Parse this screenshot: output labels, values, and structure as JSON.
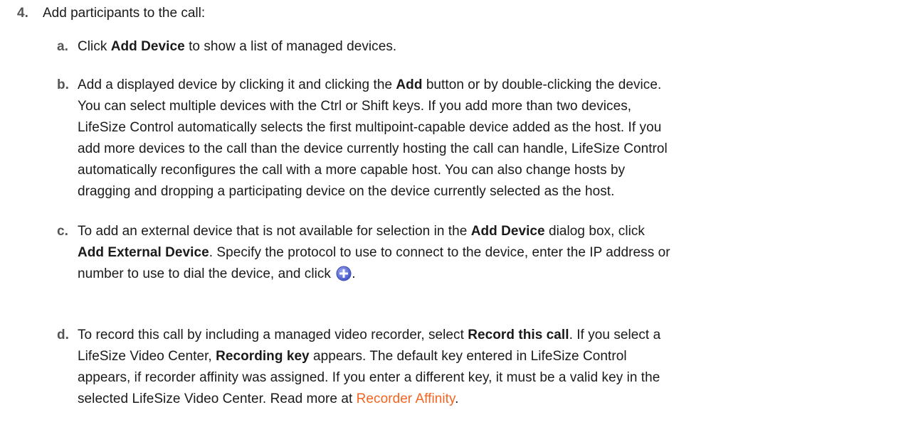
{
  "step": {
    "number": "4.",
    "text": "Add participants to the call:"
  },
  "substeps": [
    {
      "letter": "a.",
      "parts": [
        "Click ",
        "Add Device",
        " to show a list of managed devices."
      ]
    },
    {
      "letter": "b.",
      "lines": [
        [
          "Add a displayed device by clicking it and clicking the ",
          "Add",
          " button or by double-clicking the device."
        ],
        [
          "You can select multiple devices with the Ctrl or Shift keys. If you add more than two devices,"
        ],
        [
          "LifeSize Control automatically selects the first multipoint-capable device added as the host. If you"
        ],
        [
          "add more devices to the call than the device currently hosting the call can handle, LifeSize Control"
        ],
        [
          "automatically reconfigures the call with a more capable host. You can also change hosts by"
        ],
        [
          "dragging and dropping a participating device on the device currently selected as the host."
        ]
      ]
    },
    {
      "letter": "c.",
      "line1": [
        "To add an external device that is not available for selection in the ",
        "Add Device",
        " dialog box, click"
      ],
      "line2": [
        "Add External Device",
        ". Specify the protocol to use to connect to the device, enter the IP address or"
      ],
      "line3": [
        "number to use to dial the device, and click ",
        "."
      ],
      "icon": "add-circle-icon"
    },
    {
      "letter": "d.",
      "line1": [
        "To record this call by including a managed video recorder, select ",
        "Record this call",
        ". If you select a"
      ],
      "line2": [
        "LifeSize Video Center, ",
        "Recording key",
        " appears. The default key entered in LifeSize Control"
      ],
      "line3": [
        "appears, if recorder affinity was assigned. If you enter a different key, it must be a valid key in the"
      ],
      "line4": [
        "selected LifeSize Video Center. Read more at ",
        "Recorder Affinity",
        "."
      ]
    }
  ],
  "colors": {
    "text": "#1a1a1a",
    "label": "#555555",
    "link": "#f26522",
    "icon_fill": "#5b6fd6"
  }
}
